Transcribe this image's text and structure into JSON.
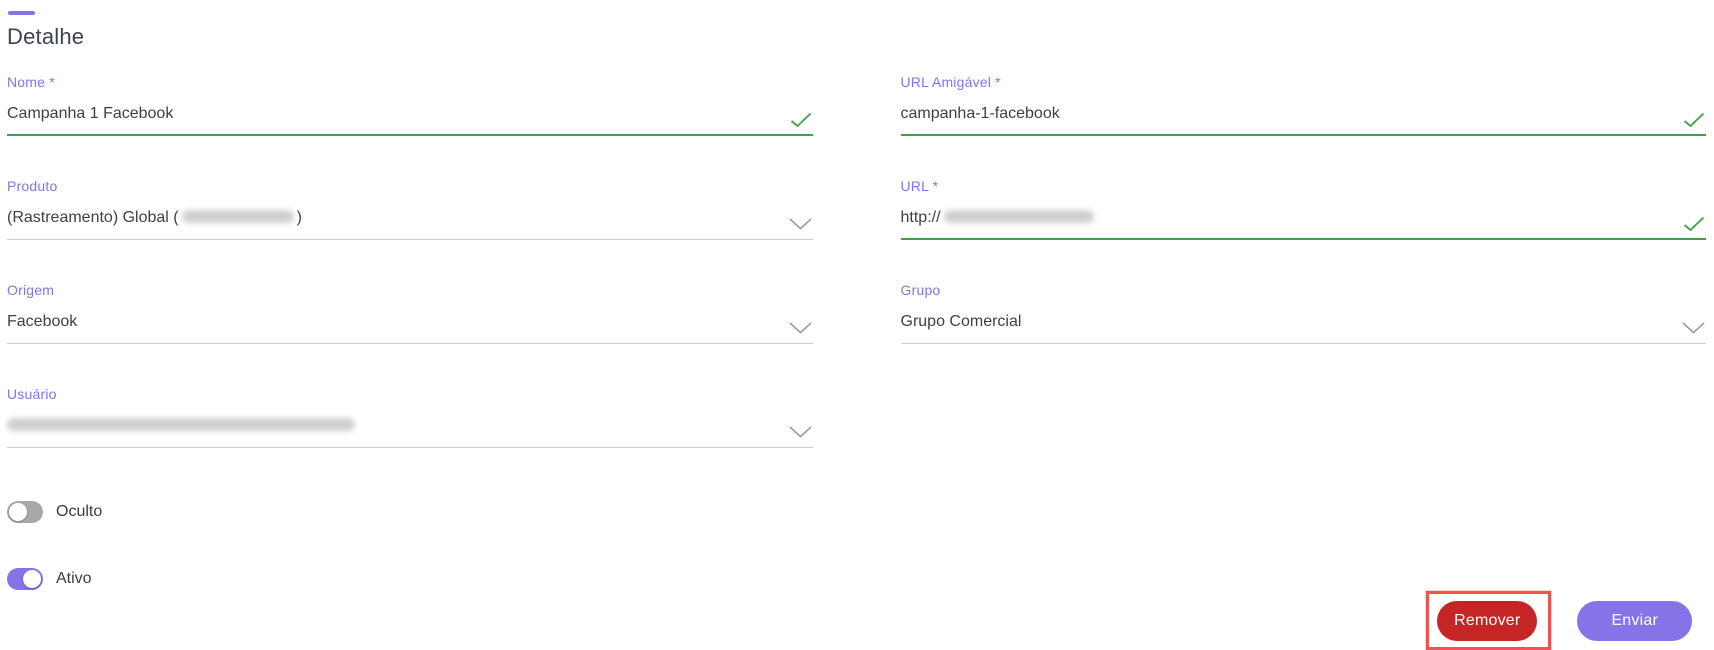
{
  "header": {
    "title": "Detalhe"
  },
  "form": {
    "fields": {
      "nome": {
        "label": "Nome *",
        "value": "Campanha 1 Facebook",
        "valid": true
      },
      "url_amigavel": {
        "label": "URL Amigável *",
        "value": "campanha-1-facebook",
        "valid": true
      },
      "produto": {
        "label": "Produto",
        "value_prefix": "(Rastreamento) Global (",
        "value_suffix": ")",
        "redacted": true
      },
      "url": {
        "label": "URL *",
        "value_prefix": "http://",
        "redacted": true,
        "valid": true
      },
      "origem": {
        "label": "Origem",
        "value": "Facebook"
      },
      "grupo": {
        "label": "Grupo",
        "value": "Grupo Comercial"
      },
      "usuario": {
        "label": "Usuário",
        "value": "",
        "redacted": true
      }
    },
    "toggles": [
      {
        "label": "Oculto",
        "state": "off"
      },
      {
        "label": "Ativo",
        "state": "on"
      }
    ],
    "buttons": {
      "remove": "Remover",
      "submit": "Enviar"
    }
  },
  "icons": {
    "valid_check": "check",
    "dropdown": "chevron-down"
  },
  "colors": {
    "accent_purple": "#8673e8",
    "label_purple": "#8672e3",
    "success_green": "#43a047",
    "danger_red": "#c42525",
    "annotation_red": "#f25251",
    "toggle_off_gray": "#a8a8a8"
  }
}
